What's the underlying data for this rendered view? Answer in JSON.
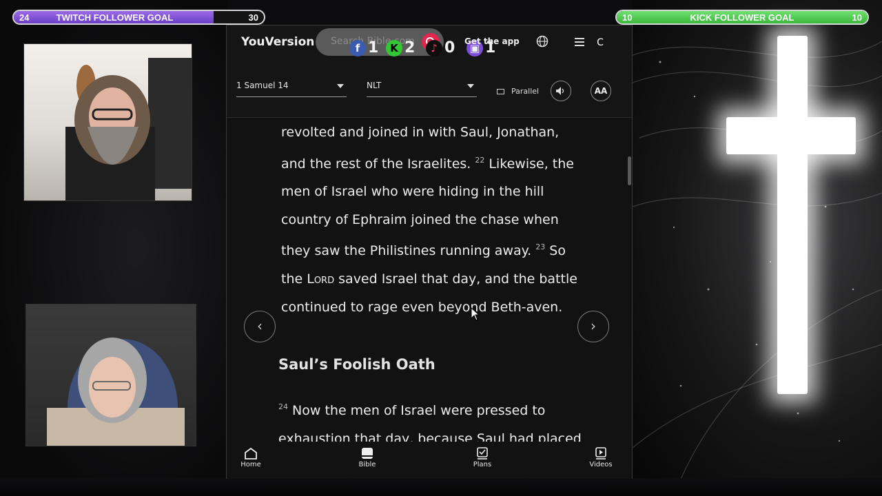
{
  "goals": {
    "twitch": {
      "current": "24",
      "title": "TWITCH FOLLOWER GOAL",
      "target": "30",
      "progress": 0.8,
      "color": "#8b5cf6"
    },
    "kick": {
      "current": "10",
      "title": "KICK FOLLOWER GOAL",
      "target": "10",
      "progress": 1.0,
      "color": "#53d453"
    }
  },
  "social_counts": {
    "facebook": "1",
    "kick": "2",
    "tiktok": "0",
    "twitch": "1"
  },
  "app": {
    "logo": "YouVersion",
    "search_placeholder": "Search Bible.com",
    "get_app": "Get the app",
    "avatar_initial": "C",
    "book_chapter": "1 Samuel 14",
    "version": "NLT",
    "parallel_label": "Parallel",
    "font_button": "AA"
  },
  "passage": {
    "line1": "revolted and joined in with Saul, Jonathan, and the rest of the Israelites.",
    "v22_num": "22",
    "v22_text": " Likewise, the men of Israel who were hiding in the hill country of Ephraim joined the chase when they saw the Philistines running away.",
    "v23_num": "23",
    "v23_pre": " So the ",
    "v23_lord": "Lord",
    "v23_post": " saved Israel that day, and the battle continued to rage even beyond Beth-aven.",
    "heading": "Saul’s Foolish Oath",
    "v24_num": "24",
    "v24_text": " Now the men of Israel were pressed to exhaustion that day, because Saul had placed them under an oath, saying, “Let a curse fall"
  },
  "tabs": {
    "home": "Home",
    "bible": "Bible",
    "plans": "Plans",
    "videos": "Videos"
  }
}
